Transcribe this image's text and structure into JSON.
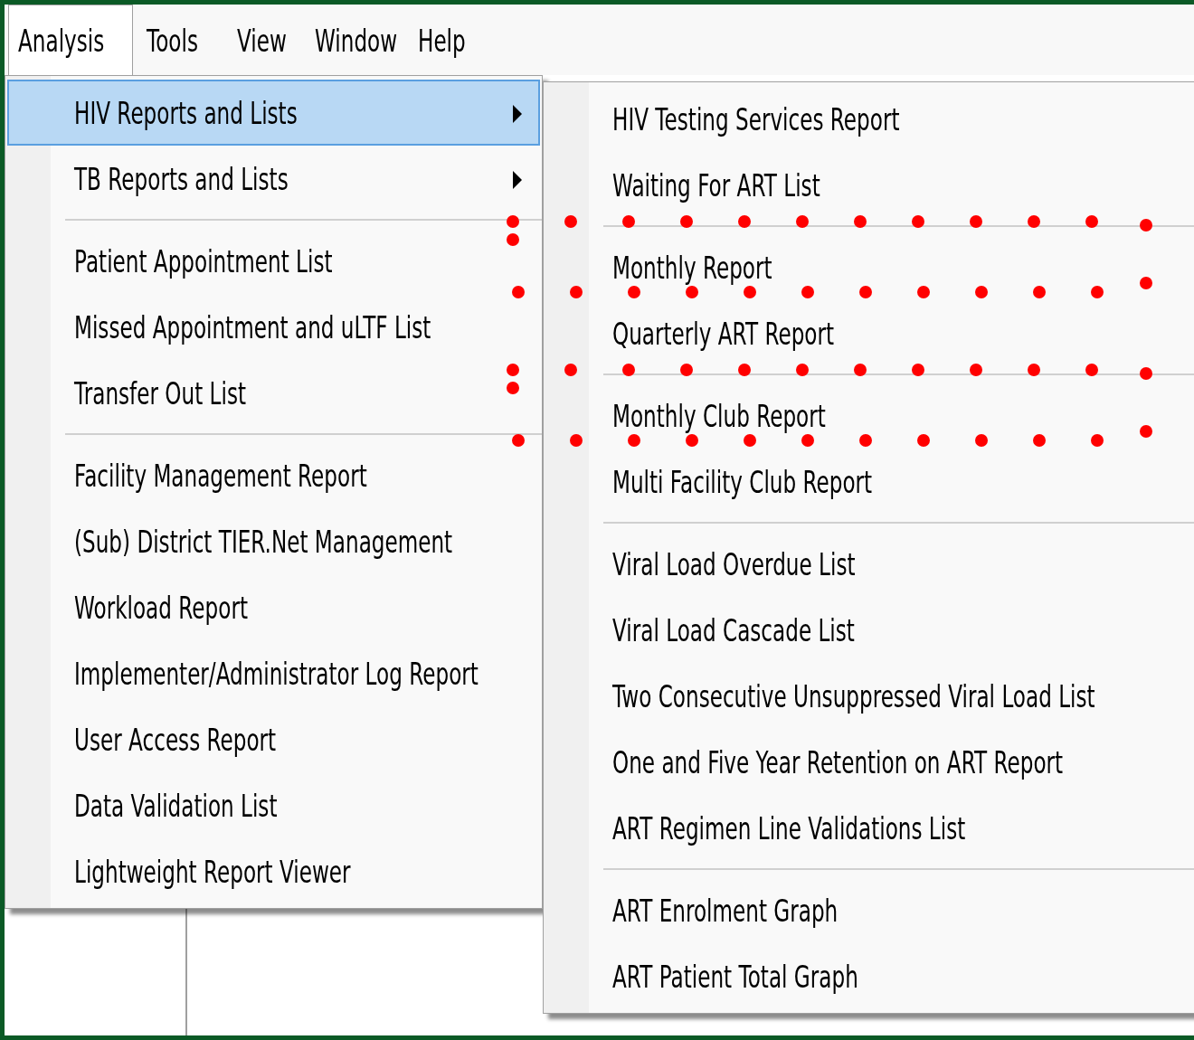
{
  "menu_bar": [
    {
      "label": "Analysis",
      "open": true
    },
    {
      "label": "Tools",
      "open": false
    },
    {
      "label": "View",
      "open": false
    },
    {
      "label": "Window",
      "open": false
    },
    {
      "label": "Help",
      "open": false
    }
  ],
  "main_menu": [
    {
      "kind": "item",
      "label": "HIV Reports and Lists",
      "has_submenu": true,
      "selected": true
    },
    {
      "kind": "item",
      "label": "TB Reports and Lists",
      "has_submenu": true,
      "selected": false
    },
    {
      "kind": "separator"
    },
    {
      "kind": "item",
      "label": "Patient Appointment List",
      "has_submenu": false,
      "selected": false
    },
    {
      "kind": "item",
      "label": "Missed Appointment and uLTF List",
      "has_submenu": false,
      "selected": false
    },
    {
      "kind": "item",
      "label": "Transfer Out List",
      "has_submenu": false,
      "selected": false
    },
    {
      "kind": "separator"
    },
    {
      "kind": "item",
      "label": "Facility Management Report",
      "has_submenu": false,
      "selected": false
    },
    {
      "kind": "item",
      "label": "(Sub) District TIER.Net Management",
      "has_submenu": false,
      "selected": false
    },
    {
      "kind": "item",
      "label": "Workload Report",
      "has_submenu": false,
      "selected": false
    },
    {
      "kind": "item",
      "label": "Implementer/Administrator Log Report",
      "has_submenu": false,
      "selected": false
    },
    {
      "kind": "item",
      "label": "User Access Report",
      "has_submenu": false,
      "selected": false
    },
    {
      "kind": "item",
      "label": "Data Validation List",
      "has_submenu": false,
      "selected": false
    },
    {
      "kind": "item",
      "label": "Lightweight Report Viewer",
      "has_submenu": false,
      "selected": false
    }
  ],
  "submenu": [
    {
      "kind": "item",
      "label": "HIV Testing Services Report",
      "highlighted": false
    },
    {
      "kind": "item",
      "label": "Waiting For ART List",
      "highlighted": false
    },
    {
      "kind": "separator"
    },
    {
      "kind": "item",
      "label": "Monthly Report",
      "highlighted": true
    },
    {
      "kind": "item",
      "label": "Quarterly ART Report",
      "highlighted": false
    },
    {
      "kind": "separator"
    },
    {
      "kind": "item",
      "label": "Monthly Club Report",
      "highlighted": true
    },
    {
      "kind": "item",
      "label": "Multi Facility Club Report",
      "highlighted": false
    },
    {
      "kind": "separator"
    },
    {
      "kind": "item",
      "label": "Viral Load Overdue List",
      "highlighted": false
    },
    {
      "kind": "item",
      "label": "Viral Load Cascade List",
      "highlighted": false
    },
    {
      "kind": "item",
      "label": "Two Consecutive Unsuppressed Viral Load List",
      "highlighted": false
    },
    {
      "kind": "item",
      "label": "One and Five Year Retention on ART Report",
      "highlighted": false
    },
    {
      "kind": "item",
      "label": "ART Regimen Line Validations List",
      "highlighted": false
    },
    {
      "kind": "separator"
    },
    {
      "kind": "item",
      "label": "ART Enrolment Graph",
      "highlighted": false
    },
    {
      "kind": "item",
      "label": "ART Patient Total Graph",
      "highlighted": false
    }
  ]
}
